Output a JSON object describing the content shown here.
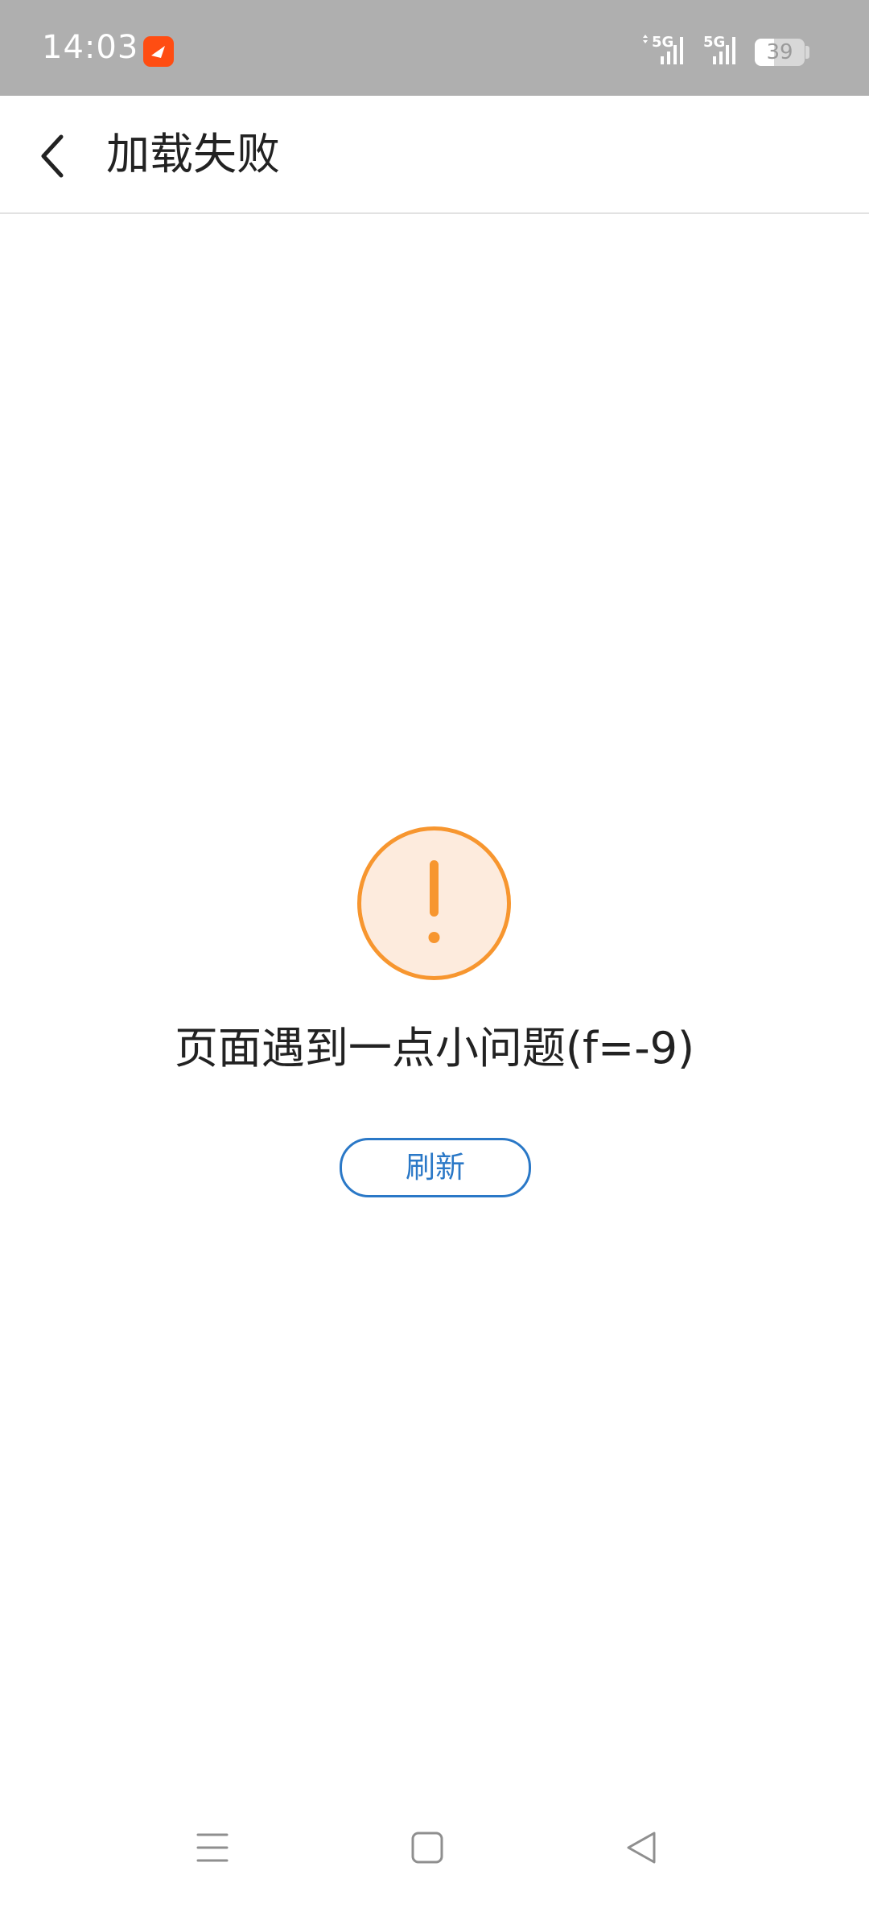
{
  "status_bar": {
    "time": "14:03",
    "signal_1_label": "5G",
    "signal_2_label": "5G",
    "battery_percent": "39",
    "battery_level": 0.39,
    "app_icon": "feishu-app-icon"
  },
  "header": {
    "back_icon": "chevron-left-icon",
    "title": "加载失败"
  },
  "error": {
    "icon": "exclamation-circle-icon",
    "icon_color": "#f7962f",
    "icon_fill": "#fdebdd",
    "message": "页面遇到一点小问题(f=-9)",
    "refresh_label": "刷新",
    "refresh_color": "#2a78c7"
  },
  "nav_bar": {
    "menu_icon": "menu-icon",
    "home_icon": "home-square-icon",
    "back_icon": "back-triangle-icon"
  }
}
